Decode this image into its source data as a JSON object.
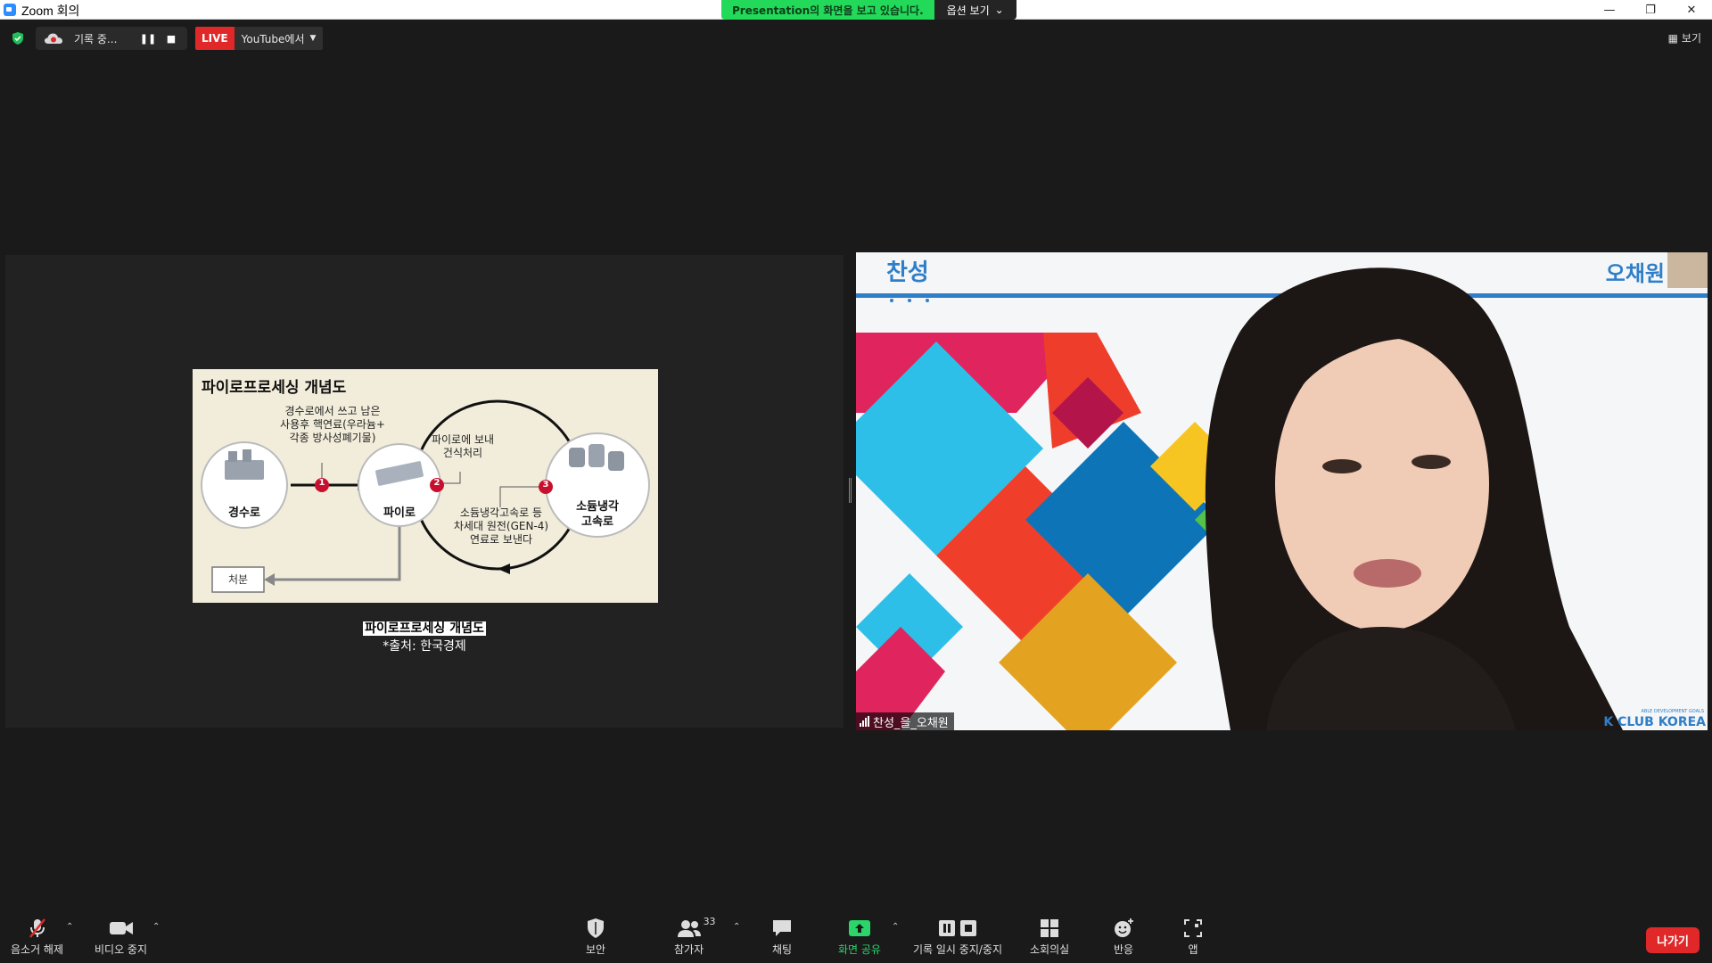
{
  "window": {
    "title": "Zoom 회의",
    "controls": [
      "minimize",
      "restore",
      "close"
    ]
  },
  "share_banner": {
    "message": "Presentation의 화면을 보고 있습니다.",
    "options_label": "옵션 보기"
  },
  "topbar": {
    "recording_label": "기록 중...",
    "live_badge": "LIVE",
    "live_target": "YouTube에서",
    "view_label": "보기"
  },
  "slide": {
    "title": "파이로프로세싱 개념도",
    "note1_l1": "경수로에서 쓰고 남은",
    "note1_l2": "사용후 핵연료(우라늄+",
    "note1_l3": "각종 방사성폐기물)",
    "note2_l1": "파이로에 보내",
    "note2_l2": "건식처리",
    "note3_l1": "소듐냉각고속로 등",
    "note3_l2": "차세대 원전(GEN-4)",
    "note3_l3": "연료로 보낸다",
    "node1": "경수로",
    "node2": "파이로",
    "node3_l1": "소듐냉각",
    "node3_l2": "고속로",
    "disposal": "처분",
    "step1": "1",
    "step2": "2",
    "step3": "3",
    "caption_title": "파이로프로세싱 개념도",
    "caption_source": "*출처: 한국경제"
  },
  "video": {
    "banner_left": "찬성",
    "banner_right": "오채원",
    "logo_small": "ABLE DEVELOPMENT GOALS",
    "logo_text": "K CLUB KOREA",
    "participant_name": "찬성_을_오채원"
  },
  "toolbar": {
    "unmute": "음소거 해제",
    "stop_video": "비디오 중지",
    "security": "보안",
    "participants": "참가자",
    "participants_count": "33",
    "chat": "채팅",
    "share_screen": "화면 공유",
    "pause_stop_recording": "기록 일시 중지/중지",
    "breakout": "소회의실",
    "reactions": "반응",
    "apps": "앱",
    "leave": "나가기"
  }
}
